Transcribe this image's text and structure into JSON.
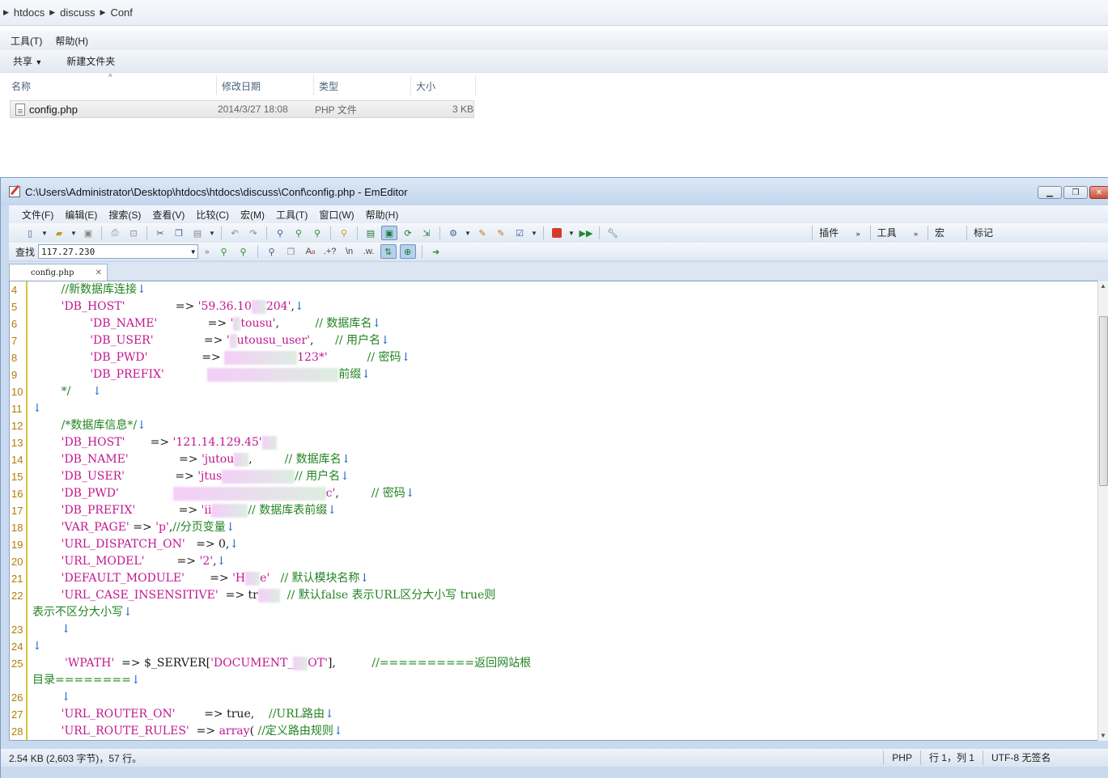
{
  "explorer": {
    "breadcrumb": [
      "htdocs",
      "discuss",
      "Conf"
    ],
    "menu": [
      "工具(T)",
      "帮助(H)"
    ],
    "commands": {
      "share": "共享",
      "new_folder": "新建文件夹"
    },
    "columns": [
      "名称",
      "修改日期",
      "类型",
      "大小"
    ],
    "file": {
      "name": "config.php",
      "date": "2014/3/27 18:08",
      "type": "PHP 文件",
      "size": "3 KB"
    }
  },
  "editor": {
    "title": "C:\\Users\\Administrator\\Desktop\\htdocs\\htdocs\\discuss\\Conf\\config.php - EmEditor",
    "menu": [
      "文件(F)",
      "编辑(E)",
      "搜索(S)",
      "查看(V)",
      "比较(C)",
      "宏(M)",
      "工具(T)",
      "窗口(W)",
      "帮助(H)"
    ],
    "toolbar_right": [
      "插件",
      "工具",
      "宏",
      "标记"
    ],
    "find": {
      "label": "查找",
      "value": "117.27.230",
      "escape_label": "\\n",
      "regex_label": ".+?"
    },
    "tab": {
      "name": "config.php"
    },
    "status": {
      "info": "2.54 KB (2,603 字节)，57 行。",
      "lang": "PHP",
      "pos": "行 1，列 1",
      "encoding": "UTF-8 无签名"
    },
    "lines": [
      {
        "n": "4",
        "segs": [
          [
            "cmt",
            "        //新数据库连接"
          ],
          [
            "nl",
            "↓"
          ]
        ]
      },
      {
        "n": "5",
        "segs": [
          [
            "str",
            "        'DB_HOST'"
          ],
          [
            "op",
            "              => "
          ],
          [
            "str",
            "'59.36.10"
          ],
          [
            "blur",
            "  "
          ],
          [
            "str",
            "204'"
          ],
          [
            "op",
            ","
          ],
          [
            "nl",
            "↓"
          ]
        ]
      },
      {
        "n": "6",
        "segs": [
          [
            "str",
            "                'DB_NAME'"
          ],
          [
            "op",
            "              => "
          ],
          [
            "str",
            "'"
          ],
          [
            "blur",
            " "
          ],
          [
            "str",
            "tousu'"
          ],
          [
            "op",
            ",          "
          ],
          [
            "cmt",
            "// 数据库名"
          ],
          [
            "nl",
            "↓"
          ]
        ]
      },
      {
        "n": "7",
        "segs": [
          [
            "str",
            "                'DB_USER'"
          ],
          [
            "op",
            "              => "
          ],
          [
            "str",
            "'"
          ],
          [
            "blur",
            " "
          ],
          [
            "str",
            "utousu_user'"
          ],
          [
            "op",
            ",      "
          ],
          [
            "cmt",
            "// 用户名"
          ],
          [
            "nl",
            "↓"
          ]
        ]
      },
      {
        "n": "8",
        "segs": [
          [
            "str",
            "                'DB_PWD'"
          ],
          [
            "op",
            "               => "
          ],
          [
            "blur",
            "          "
          ],
          [
            "str",
            "123*'"
          ],
          [
            "op",
            "           "
          ],
          [
            "cmt",
            "// 密码"
          ],
          [
            "nl",
            "↓"
          ]
        ]
      },
      {
        "n": "9",
        "segs": [
          [
            "str",
            "                'DB_PREFIX'"
          ],
          [
            "op",
            "            "
          ],
          [
            "blur",
            "                  "
          ],
          [
            "cmt",
            "前缀"
          ],
          [
            "nl",
            "↓"
          ]
        ]
      },
      {
        "n": "10",
        "segs": [
          [
            "cmt",
            "        */      "
          ],
          [
            "nl",
            "↓"
          ]
        ]
      },
      {
        "n": "11",
        "segs": [
          [
            "nl",
            "↓"
          ]
        ]
      },
      {
        "n": "12",
        "segs": [
          [
            "cmt",
            "        /*数据库信息*/"
          ],
          [
            "nl",
            "↓"
          ]
        ]
      },
      {
        "n": "13",
        "segs": [
          [
            "str",
            "        'DB_HOST'"
          ],
          [
            "op",
            "       => "
          ],
          [
            "str",
            "'121.14.129.45'"
          ],
          [
            "blur",
            "  "
          ]
        ]
      },
      {
        "n": "14",
        "segs": [
          [
            "str",
            "        'DB_NAME'"
          ],
          [
            "op",
            "              => "
          ],
          [
            "str",
            "'jutou"
          ],
          [
            "blur",
            "  "
          ],
          [
            "op",
            ",         "
          ],
          [
            "cmt",
            "// 数据库名"
          ],
          [
            "nl",
            "↓"
          ]
        ]
      },
      {
        "n": "15",
        "segs": [
          [
            "str",
            "        'DB_USER'"
          ],
          [
            "op",
            "              => "
          ],
          [
            "str",
            "'jtus"
          ],
          [
            "blur",
            "          "
          ],
          [
            "cmt",
            "// 用户名"
          ],
          [
            "nl",
            "↓"
          ]
        ]
      },
      {
        "n": "16",
        "segs": [
          [
            "str",
            "        'DB_PWD'"
          ],
          [
            "op",
            "               "
          ],
          [
            "blur",
            "                     "
          ],
          [
            "str",
            "c'"
          ],
          [
            "op",
            ",         "
          ],
          [
            "cmt",
            "// 密码"
          ],
          [
            "nl",
            "↓"
          ]
        ]
      },
      {
        "n": "17",
        "segs": [
          [
            "str",
            "        'DB_PREFIX'"
          ],
          [
            "op",
            "            => "
          ],
          [
            "str",
            "'ii"
          ],
          [
            "blur",
            "     "
          ],
          [
            "cmt",
            "// 数据库表前缀"
          ],
          [
            "nl",
            "↓"
          ]
        ]
      },
      {
        "n": "18",
        "segs": [
          [
            "str",
            "        'VAR_PAGE'"
          ],
          [
            "op",
            " => "
          ],
          [
            "str",
            "'p'"
          ],
          [
            "op",
            ","
          ],
          [
            "cmt",
            "//分页变量"
          ],
          [
            "nl",
            "↓"
          ]
        ]
      },
      {
        "n": "19",
        "segs": [
          [
            "str",
            "        'URL_DISPATCH_ON'"
          ],
          [
            "op",
            "   => 0,"
          ],
          [
            "nl",
            "↓"
          ]
        ]
      },
      {
        "n": "20",
        "segs": [
          [
            "str",
            "        'URL_MODEL'"
          ],
          [
            "op",
            "         => "
          ],
          [
            "str",
            "'2'"
          ],
          [
            "op",
            ","
          ],
          [
            "nl",
            "↓"
          ]
        ]
      },
      {
        "n": "21",
        "segs": [
          [
            "str",
            "        'DEFAULT_MODULE'"
          ],
          [
            "op",
            "       => "
          ],
          [
            "str",
            "'H"
          ],
          [
            "blur",
            "  "
          ],
          [
            "str",
            "e'"
          ],
          [
            "op",
            "   "
          ],
          [
            "cmt",
            "// 默认模块名称"
          ],
          [
            "nl",
            "↓"
          ]
        ]
      },
      {
        "n": "22",
        "segs": [
          [
            "str",
            "        'URL_CASE_INSENSITIVE'"
          ],
          [
            "op",
            "  => tr"
          ],
          [
            "blur",
            "   "
          ],
          [
            "op",
            "  "
          ],
          [
            "cmt",
            "// 默认false 表示URL区分大小写 true则"
          ]
        ]
      },
      {
        "n": "",
        "segs": [
          [
            "cmt",
            "表示不区分大小写"
          ],
          [
            "nl",
            "↓"
          ]
        ]
      },
      {
        "n": "23",
        "segs": [
          [
            "op",
            "        "
          ],
          [
            "nl",
            "↓"
          ]
        ]
      },
      {
        "n": "24",
        "segs": [
          [
            "nl",
            "↓"
          ]
        ]
      },
      {
        "n": "25",
        "segs": [
          [
            "str",
            "         'WPATH'"
          ],
          [
            "op",
            "  => $_SERVER["
          ],
          [
            "str",
            "'DOCUMENT_"
          ],
          [
            "blur",
            "  "
          ],
          [
            "str",
            "OT'"
          ],
          [
            "op",
            "],          "
          ],
          [
            "cmt",
            "//==========返回网站根"
          ]
        ]
      },
      {
        "n": "",
        "segs": [
          [
            "cmt",
            "目录========"
          ],
          [
            "nl",
            "↓"
          ]
        ]
      },
      {
        "n": "26",
        "segs": [
          [
            "op",
            "        "
          ],
          [
            "nl",
            "↓"
          ]
        ]
      },
      {
        "n": "27",
        "segs": [
          [
            "str",
            "        'URL_ROUTER_ON'"
          ],
          [
            "op",
            "        => true,    "
          ],
          [
            "cmt",
            "//URL路由"
          ],
          [
            "nl",
            "↓"
          ]
        ]
      },
      {
        "n": "28",
        "segs": [
          [
            "str",
            "        'URL_ROUTE_RULES'"
          ],
          [
            "op",
            "  => "
          ],
          [
            "kw",
            "array"
          ],
          [
            "op",
            "( "
          ],
          [
            "cmt",
            "//定义路由规则"
          ],
          [
            "nl",
            "↓"
          ]
        ]
      }
    ]
  }
}
